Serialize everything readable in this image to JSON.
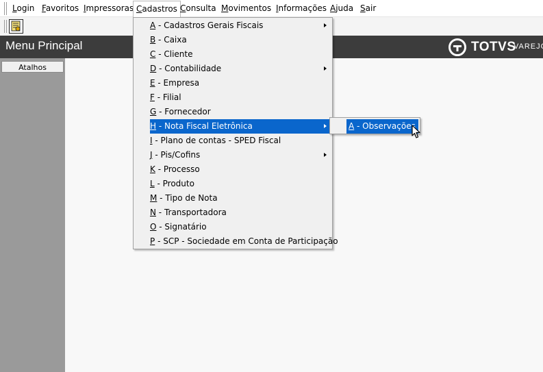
{
  "menubar": {
    "items": [
      {
        "key": "L",
        "rest": "ogin"
      },
      {
        "key": "F",
        "rest": "avoritos"
      },
      {
        "key": "I",
        "rest": "mpressoras"
      },
      {
        "key": "C",
        "rest": "adastros"
      },
      {
        "key": "C",
        "rest": "onsulta"
      },
      {
        "key": "M",
        "rest": "ovimentos"
      },
      {
        "key": "I",
        "rest": "nformações"
      },
      {
        "key": "A",
        "rest": "juda"
      },
      {
        "key": "S",
        "rest": "air"
      }
    ]
  },
  "toolbar": {
    "icon": "report-icon"
  },
  "header": {
    "title": "Menu Principal",
    "brand": "TOTVS",
    "brand_sub": "VAREJO"
  },
  "leftpanel": {
    "tab_label": "Atalhos"
  },
  "cadastros_menu": {
    "items": [
      {
        "key": "A",
        "rest": " - Cadastros Gerais Fiscais",
        "submenu": true
      },
      {
        "key": "B",
        "rest": " - Caixa",
        "submenu": false
      },
      {
        "key": "C",
        "rest": " - Cliente",
        "submenu": false
      },
      {
        "key": "D",
        "rest": " - Contabilidade",
        "submenu": true
      },
      {
        "key": "E",
        "rest": " - Empresa",
        "submenu": false
      },
      {
        "key": "F",
        "rest": " - Filial",
        "submenu": false
      },
      {
        "key": "G",
        "rest": " - Fornecedor",
        "submenu": false
      },
      {
        "key": "H",
        "rest": " - Nota Fiscal Eletrônica",
        "submenu": true
      },
      {
        "key": "I",
        "rest": " - Plano de contas - SPED Fiscal",
        "submenu": false
      },
      {
        "key": "J",
        "rest": " - Pis/Cofins",
        "submenu": true
      },
      {
        "key": "K",
        "rest": " - Processo",
        "submenu": false
      },
      {
        "key": "L",
        "rest": " - Produto",
        "submenu": false
      },
      {
        "key": "M",
        "rest": " - Tipo de Nota",
        "submenu": false
      },
      {
        "key": "N",
        "rest": " - Transportadora",
        "submenu": false
      },
      {
        "key": "O",
        "rest": " - Signatário",
        "submenu": false
      },
      {
        "key": "P",
        "rest": " - SCP - Sociedade em Conta de Participação",
        "submenu": false
      }
    ]
  },
  "nfe_submenu": {
    "items": [
      {
        "key": "A",
        "rest": " - Observações"
      }
    ]
  },
  "colors": {
    "highlight": "#0a66cc",
    "header_bg": "#3c3c3c",
    "panel_bg": "#9a9a9a"
  }
}
